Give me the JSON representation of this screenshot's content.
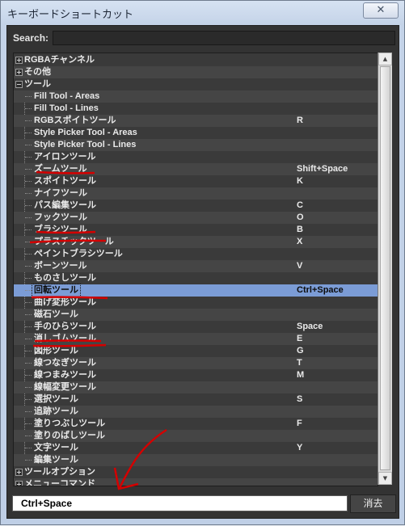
{
  "window": {
    "title": "キーボードショートカット",
    "close_glyph": "✕"
  },
  "search": {
    "label": "Search:",
    "value": ""
  },
  "tree": {
    "groups_top": [
      {
        "label": "RGBAチャンネル",
        "expanded": false
      },
      {
        "label": "その他",
        "expanded": false
      },
      {
        "label": "ツール",
        "expanded": true
      }
    ],
    "tools": [
      {
        "label": "Fill Tool - Areas",
        "key": ""
      },
      {
        "label": "Fill Tool - Lines",
        "key": ""
      },
      {
        "label": "RGBスポイトツール",
        "key": "R"
      },
      {
        "label": "Style Picker Tool - Areas",
        "key": ""
      },
      {
        "label": "Style Picker Tool - Lines",
        "key": ""
      },
      {
        "label": "アイロンツール",
        "key": ""
      },
      {
        "label": "ズームツール",
        "key": "Shift+Space"
      },
      {
        "label": "スポイトツール",
        "key": "K"
      },
      {
        "label": "ナイフツール",
        "key": ""
      },
      {
        "label": "パス編集ツール",
        "key": "C"
      },
      {
        "label": "フックツール",
        "key": "O"
      },
      {
        "label": "ブラシツール",
        "key": "B"
      },
      {
        "label": "プラスチックツール",
        "key": "X"
      },
      {
        "label": "ペイントブラシツール",
        "key": ""
      },
      {
        "label": "ボーンツール",
        "key": "V"
      },
      {
        "label": "ものさしツール",
        "key": ""
      },
      {
        "label": "回転ツール",
        "key": "Ctrl+Space",
        "selected": true
      },
      {
        "label": "曲げ変形ツール",
        "key": ""
      },
      {
        "label": "磁石ツール",
        "key": ""
      },
      {
        "label": "手のひらツール",
        "key": "Space"
      },
      {
        "label": "消しゴムツール",
        "key": "E"
      },
      {
        "label": "図形ツール",
        "key": "G"
      },
      {
        "label": "線つなぎツール",
        "key": "T"
      },
      {
        "label": "線つまみツール",
        "key": "M"
      },
      {
        "label": "線幅変更ツール",
        "key": ""
      },
      {
        "label": "選択ツール",
        "key": "S"
      },
      {
        "label": "追跡ツール",
        "key": ""
      },
      {
        "label": "塗りつぶしツール",
        "key": "F"
      },
      {
        "label": "塗りのばしツール",
        "key": ""
      },
      {
        "label": "文字ツール",
        "key": "Y"
      },
      {
        "label": "編集ツール",
        "key": ""
      }
    ],
    "groups_bottom": [
      {
        "label": "ツールオプション",
        "expanded": false
      },
      {
        "label": "メニューコマンド",
        "expanded": false
      }
    ]
  },
  "shortcut_field": {
    "value": "Ctrl+Space"
  },
  "clear_button": {
    "label": "消去"
  },
  "colors": {
    "panel_bg": "#333333",
    "selection": "#7b9cd6",
    "annotation": "#d40000"
  }
}
